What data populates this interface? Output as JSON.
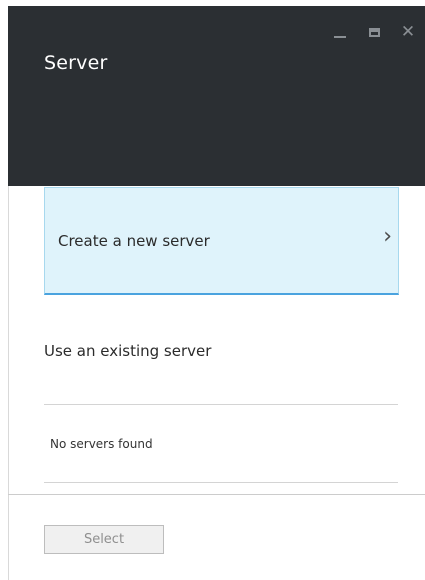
{
  "header": {
    "title": "Server",
    "bg_color": "#2b2f33",
    "controls": {
      "minimize_icon": "minimize-icon",
      "maximize_icon": "maximize-icon",
      "close_icon": "close-icon",
      "close_glyph": "✕"
    }
  },
  "create_option": {
    "label": "Create a new server",
    "chevron": "›",
    "bg_color": "#dff3fb",
    "accent_color": "#4aa3df"
  },
  "existing": {
    "section_label": "Use an existing server",
    "empty_message": "No servers found"
  },
  "footer": {
    "select_label": "Select",
    "select_state": "disabled"
  }
}
